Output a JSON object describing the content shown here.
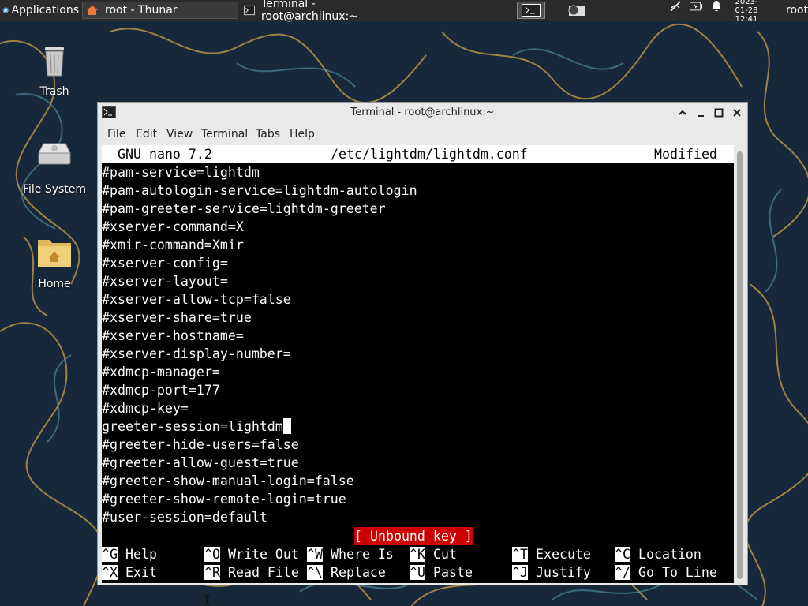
{
  "panel": {
    "applications_label": "Applications",
    "tasks": [
      {
        "label": "root - Thunar"
      },
      {
        "label": "Terminal - root@archlinux:~"
      }
    ],
    "clock_date": "2023-01-28",
    "clock_time": "12:41",
    "user": "root"
  },
  "desktop": {
    "icons": [
      {
        "label": "Trash"
      },
      {
        "label": "File System"
      },
      {
        "label": "Home"
      }
    ]
  },
  "window": {
    "title": "Terminal - root@archlinux:~",
    "menu": [
      "File",
      "Edit",
      "View",
      "Terminal",
      "Tabs",
      "Help"
    ]
  },
  "nano": {
    "version": "GNU nano 7.2",
    "filename": "/etc/lightdm/lightdm.conf",
    "state": "Modified",
    "lines": [
      "#pam-service=lightdm",
      "#pam-autologin-service=lightdm-autologin",
      "#pam-greeter-service=lightdm-greeter",
      "#xserver-command=X",
      "#xmir-command=Xmir",
      "#xserver-config=",
      "#xserver-layout=",
      "#xserver-allow-tcp=false",
      "#xserver-share=true",
      "#xserver-hostname=",
      "#xserver-display-number=",
      "#xdmcp-manager=",
      "#xdmcp-port=177",
      "#xdmcp-key=",
      "greeter-session=lightdm",
      "#greeter-hide-users=false",
      "#greeter-allow-guest=true",
      "#greeter-show-manual-login=false",
      "#greeter-show-remote-login=true",
      "#user-session=default"
    ],
    "status_message": "[ Unbound key ]",
    "shortcuts_row1": [
      {
        "key": "^G",
        "label": "Help"
      },
      {
        "key": "^O",
        "label": "Write Out"
      },
      {
        "key": "^W",
        "label": "Where Is"
      },
      {
        "key": "^K",
        "label": "Cut"
      },
      {
        "key": "^T",
        "label": "Execute"
      },
      {
        "key": "^C",
        "label": "Location"
      }
    ],
    "shortcuts_row2": [
      {
        "key": "^X",
        "label": "Exit"
      },
      {
        "key": "^R",
        "label": "Read File"
      },
      {
        "key": "^\\",
        "label": "Replace"
      },
      {
        "key": "^U",
        "label": "Paste"
      },
      {
        "key": "^J",
        "label": "Justify"
      },
      {
        "key": "^/",
        "label": "Go To Line"
      }
    ]
  }
}
